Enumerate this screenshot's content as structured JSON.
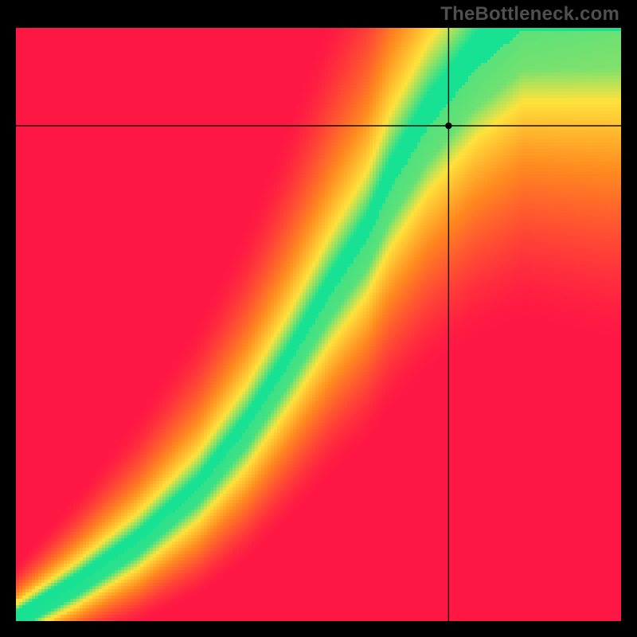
{
  "watermark": "TheBottleneck.com",
  "colors": {
    "red": "#ff1744",
    "orange": "#ff8a1f",
    "yellow": "#ffe23c",
    "green": "#17e193",
    "background": "#000000",
    "crosshair": "#000000",
    "watermark_text": "#4f4f4f"
  },
  "chart_data": {
    "type": "heatmap",
    "title": "",
    "xlabel": "",
    "ylabel": "",
    "xlim": [
      0,
      100
    ],
    "ylim": [
      0,
      100
    ],
    "note": "Heatmap of compatibility/bottleneck score. Green = optimal, yellow = borderline, orange/red = bottleneck. The green optimal band runs diagonally but curved (S-shape) from bottom-left toward upper-middle-right.",
    "crosshair_point": {
      "x": 71.5,
      "y": 83.5
    },
    "optimal_band_anchors": [
      {
        "x": 0,
        "center_y": 0,
        "halfwidth": 1.5
      },
      {
        "x": 10,
        "center_y": 6,
        "halfwidth": 1.8
      },
      {
        "x": 20,
        "center_y": 13,
        "halfwidth": 2.0
      },
      {
        "x": 30,
        "center_y": 22,
        "halfwidth": 2.3
      },
      {
        "x": 38,
        "center_y": 32,
        "halfwidth": 2.8
      },
      {
        "x": 45,
        "center_y": 43,
        "halfwidth": 3.2
      },
      {
        "x": 52,
        "center_y": 55,
        "halfwidth": 3.8
      },
      {
        "x": 58,
        "center_y": 64,
        "halfwidth": 4.4
      },
      {
        "x": 62,
        "center_y": 73,
        "halfwidth": 5.0
      },
      {
        "x": 68,
        "center_y": 83,
        "halfwidth": 5.6
      },
      {
        "x": 76,
        "center_y": 93,
        "halfwidth": 6.2
      },
      {
        "x": 84,
        "center_y": 100,
        "halfwidth": 6.8
      }
    ]
  }
}
